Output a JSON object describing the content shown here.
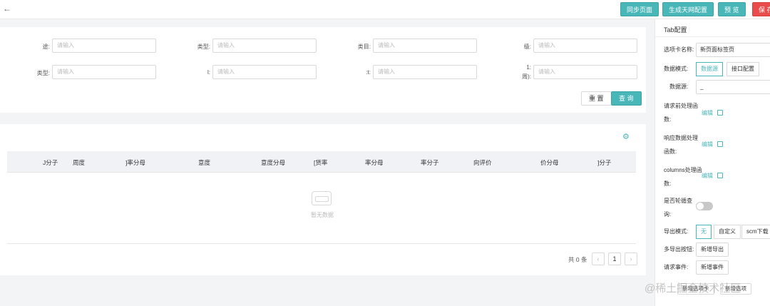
{
  "topbar": {
    "back_icon": "←",
    "buttons": {
      "sync": "同步页面",
      "generate": "生成天网配置",
      "preview": "预 览",
      "save": "保 存"
    }
  },
  "filters": {
    "placeholder": "请输入",
    "row1": [
      {
        "label": "途:"
      },
      {
        "label": "类型:"
      },
      {
        "label": "类目:"
      },
      {
        "label": "级:"
      }
    ],
    "row2": [
      {
        "label": "类型:"
      },
      {
        "label": "l:"
      },
      {
        "label": ":t:"
      },
      {
        "label": "1:",
        "label2": "周):"
      }
    ],
    "reset_label": "重 置",
    "query_label": "查 询"
  },
  "table": {
    "columns": [
      "J分子",
      "周度",
      "]率分母",
      "意度",
      "意度分母",
      "[货率",
      "率分母",
      "率分子",
      "向评价",
      "价分母",
      "]分子"
    ],
    "empty_text": "暂无数据",
    "pager": {
      "total": "共 0 条",
      "prev": "‹",
      "current": "1",
      "next": "›"
    }
  },
  "config_panel": {
    "title": "Tab配置",
    "tab_name_label": "选项卡名称:",
    "tab_name_value": "新页面标签页",
    "data_mode_label": "数据模式:",
    "data_mode_options": [
      "数据源",
      "接口配置"
    ],
    "datasource_label": "数据源:",
    "datasource_value": "_",
    "pre_request_label": "请求前处理函数:",
    "response_label": "响应数据处理函数:",
    "columns_label": "columns处理函数:",
    "edit_label": "编辑",
    "polling_label": "是否轮循查询:",
    "export_mode_label": "导出模式:",
    "export_mode_options": [
      "无",
      "自定义",
      "scm下载"
    ],
    "multi_export_label": "多导出按钮:",
    "add_export_label": "新增导出",
    "request_event_label": "请求事件:",
    "add_event_label": "新增事件",
    "overlay_buttons": [
      "新增选项卡",
      "新增选项"
    ]
  },
  "watermark": "@稀土掘金技术社区",
  "colors": {
    "primary": "#49b6b8",
    "danger": "#e84c4c"
  }
}
